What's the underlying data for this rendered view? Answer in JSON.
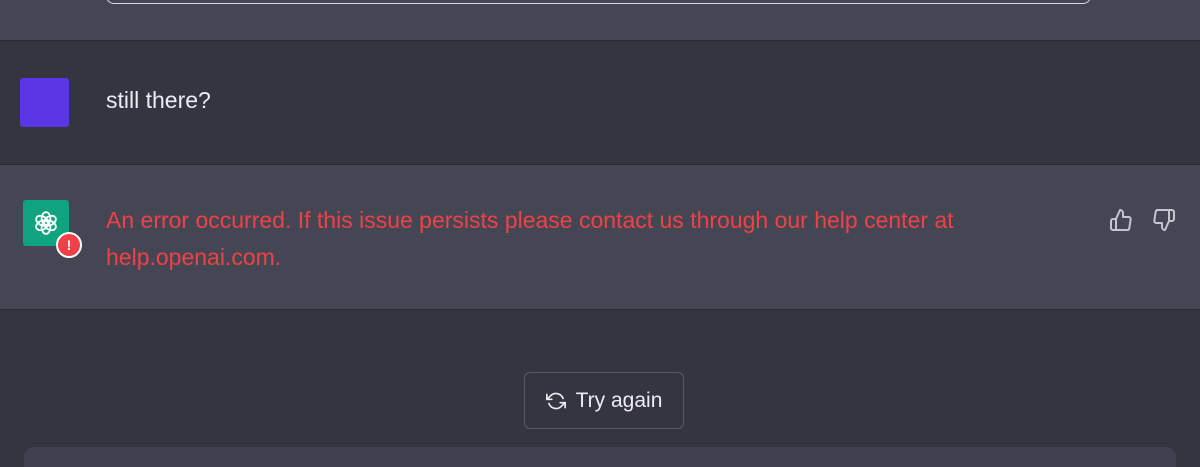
{
  "user_message": {
    "text": "still there?",
    "avatar_color": "#5b36e4"
  },
  "assistant_message": {
    "avatar_icon": "openai-logo-icon",
    "avatar_color": "#10a37f",
    "error_badge": "!",
    "error_text": "An error occurred. If this issue persists please contact us through our help center at help.openai.com.",
    "error_color": "#ef4146"
  },
  "feedback": {
    "thumbs_up_icon": "thumbs-up-icon",
    "thumbs_down_icon": "thumbs-down-icon"
  },
  "regenerate": {
    "icon": "refresh-icon",
    "label": "Try again"
  }
}
